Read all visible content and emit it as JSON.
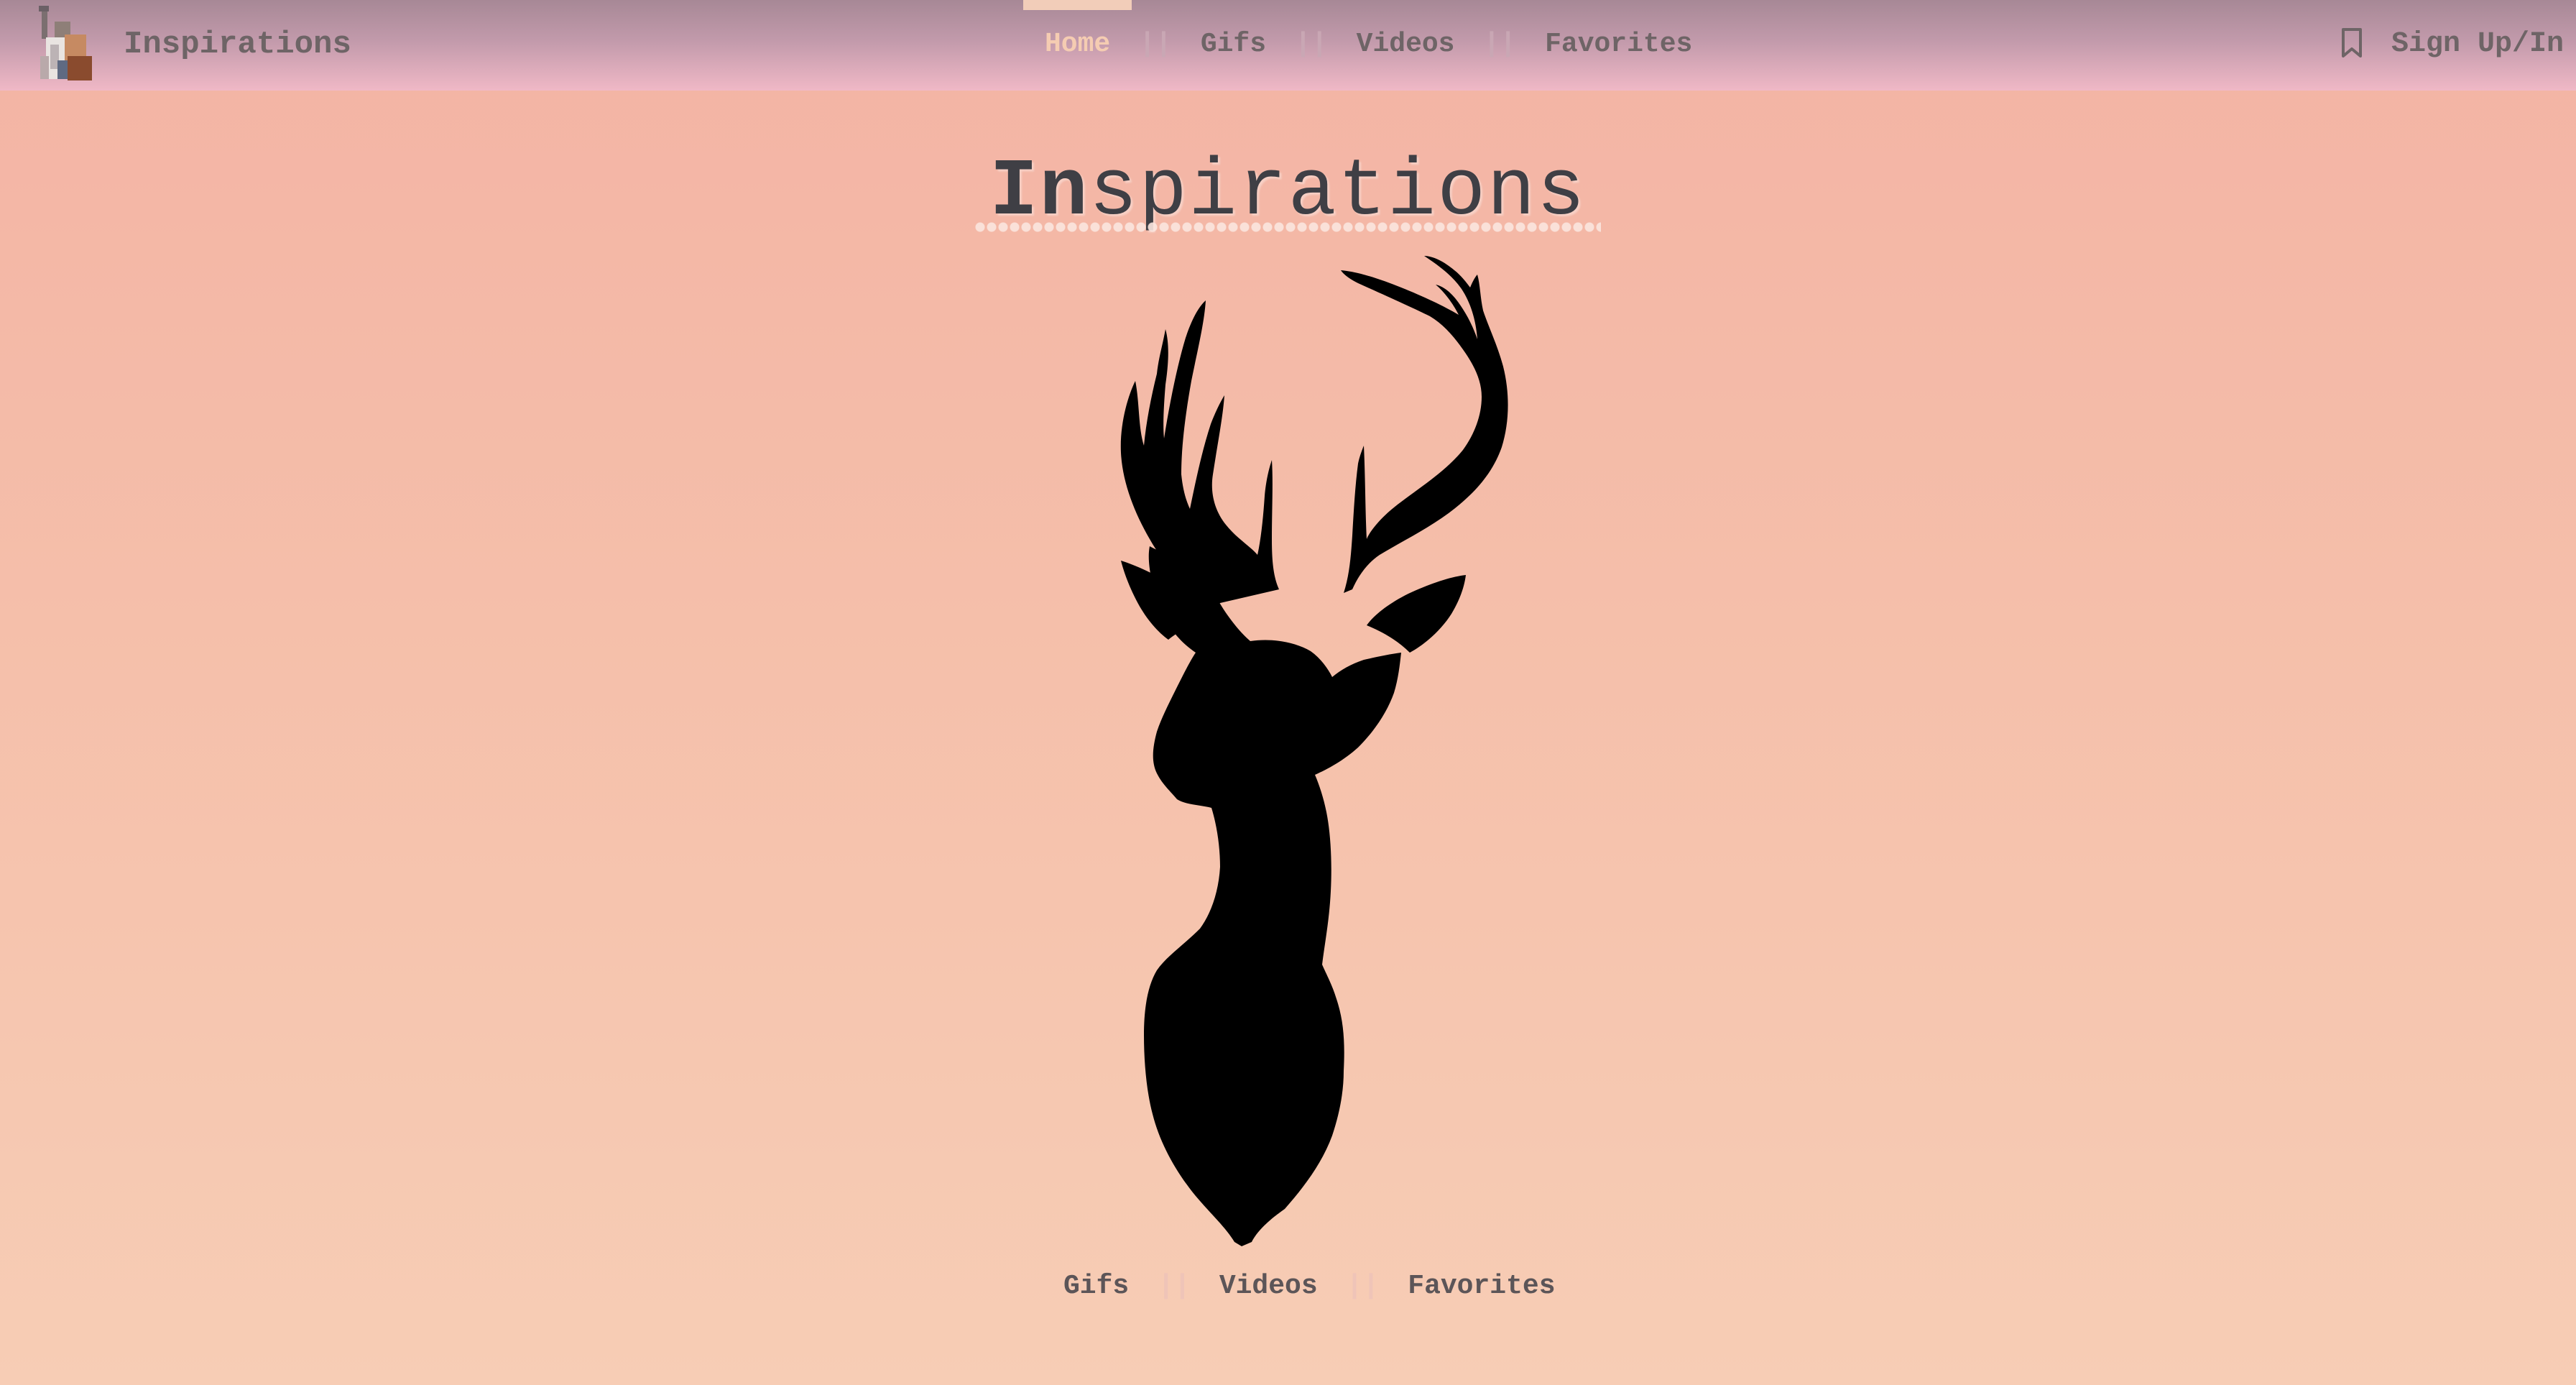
{
  "brand": {
    "name": "Inspirations",
    "logo_icon": "collage-logo-icon"
  },
  "nav": {
    "items": [
      {
        "label": "Home",
        "active": true
      },
      {
        "label": "Gifs",
        "active": false
      },
      {
        "label": "Videos",
        "active": false
      },
      {
        "label": "Favorites",
        "active": false
      }
    ],
    "separator": "||",
    "bookmark_icon": "bookmark-icon",
    "sign_label": "Sign Up/In"
  },
  "hero": {
    "title_strong": "In",
    "title_rest": "spirations",
    "image_icon": "deer-head-silhouette"
  },
  "footer_nav": {
    "items": [
      {
        "label": "Gifs"
      },
      {
        "label": "Videos"
      },
      {
        "label": "Favorites"
      }
    ],
    "separator": "||"
  },
  "colors": {
    "background_top": "#f3b3a4",
    "background_bottom": "#f7cdb5",
    "navbar_top": "#a78896",
    "navbar_bottom": "#f0b8c6",
    "nav_text": "#6e6466",
    "active_text": "#f5ccb2",
    "title_text": "#3f3f45",
    "deer": "#000000"
  }
}
